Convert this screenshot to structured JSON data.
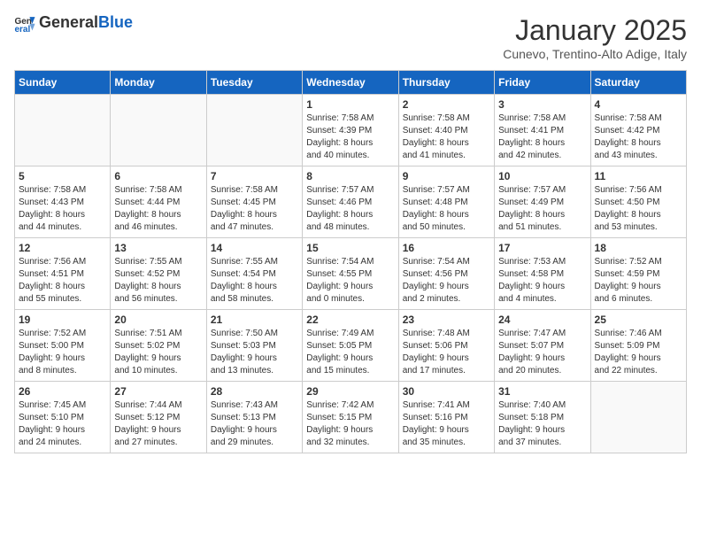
{
  "header": {
    "logo_general": "General",
    "logo_blue": "Blue",
    "title": "January 2025",
    "subtitle": "Cunevo, Trentino-Alto Adige, Italy"
  },
  "days_of_week": [
    "Sunday",
    "Monday",
    "Tuesday",
    "Wednesday",
    "Thursday",
    "Friday",
    "Saturday"
  ],
  "weeks": [
    {
      "alt": false,
      "days": [
        {
          "num": "",
          "empty": true
        },
        {
          "num": "",
          "empty": true
        },
        {
          "num": "",
          "empty": true
        },
        {
          "num": "1",
          "info": "Sunrise: 7:58 AM\nSunset: 4:39 PM\nDaylight: 8 hours\nand 40 minutes."
        },
        {
          "num": "2",
          "info": "Sunrise: 7:58 AM\nSunset: 4:40 PM\nDaylight: 8 hours\nand 41 minutes."
        },
        {
          "num": "3",
          "info": "Sunrise: 7:58 AM\nSunset: 4:41 PM\nDaylight: 8 hours\nand 42 minutes."
        },
        {
          "num": "4",
          "info": "Sunrise: 7:58 AM\nSunset: 4:42 PM\nDaylight: 8 hours\nand 43 minutes."
        }
      ]
    },
    {
      "alt": true,
      "days": [
        {
          "num": "5",
          "info": "Sunrise: 7:58 AM\nSunset: 4:43 PM\nDaylight: 8 hours\nand 44 minutes."
        },
        {
          "num": "6",
          "info": "Sunrise: 7:58 AM\nSunset: 4:44 PM\nDaylight: 8 hours\nand 46 minutes."
        },
        {
          "num": "7",
          "info": "Sunrise: 7:58 AM\nSunset: 4:45 PM\nDaylight: 8 hours\nand 47 minutes."
        },
        {
          "num": "8",
          "info": "Sunrise: 7:57 AM\nSunset: 4:46 PM\nDaylight: 8 hours\nand 48 minutes."
        },
        {
          "num": "9",
          "info": "Sunrise: 7:57 AM\nSunset: 4:48 PM\nDaylight: 8 hours\nand 50 minutes."
        },
        {
          "num": "10",
          "info": "Sunrise: 7:57 AM\nSunset: 4:49 PM\nDaylight: 8 hours\nand 51 minutes."
        },
        {
          "num": "11",
          "info": "Sunrise: 7:56 AM\nSunset: 4:50 PM\nDaylight: 8 hours\nand 53 minutes."
        }
      ]
    },
    {
      "alt": false,
      "days": [
        {
          "num": "12",
          "info": "Sunrise: 7:56 AM\nSunset: 4:51 PM\nDaylight: 8 hours\nand 55 minutes."
        },
        {
          "num": "13",
          "info": "Sunrise: 7:55 AM\nSunset: 4:52 PM\nDaylight: 8 hours\nand 56 minutes."
        },
        {
          "num": "14",
          "info": "Sunrise: 7:55 AM\nSunset: 4:54 PM\nDaylight: 8 hours\nand 58 minutes."
        },
        {
          "num": "15",
          "info": "Sunrise: 7:54 AM\nSunset: 4:55 PM\nDaylight: 9 hours\nand 0 minutes."
        },
        {
          "num": "16",
          "info": "Sunrise: 7:54 AM\nSunset: 4:56 PM\nDaylight: 9 hours\nand 2 minutes."
        },
        {
          "num": "17",
          "info": "Sunrise: 7:53 AM\nSunset: 4:58 PM\nDaylight: 9 hours\nand 4 minutes."
        },
        {
          "num": "18",
          "info": "Sunrise: 7:52 AM\nSunset: 4:59 PM\nDaylight: 9 hours\nand 6 minutes."
        }
      ]
    },
    {
      "alt": true,
      "days": [
        {
          "num": "19",
          "info": "Sunrise: 7:52 AM\nSunset: 5:00 PM\nDaylight: 9 hours\nand 8 minutes."
        },
        {
          "num": "20",
          "info": "Sunrise: 7:51 AM\nSunset: 5:02 PM\nDaylight: 9 hours\nand 10 minutes."
        },
        {
          "num": "21",
          "info": "Sunrise: 7:50 AM\nSunset: 5:03 PM\nDaylight: 9 hours\nand 13 minutes."
        },
        {
          "num": "22",
          "info": "Sunrise: 7:49 AM\nSunset: 5:05 PM\nDaylight: 9 hours\nand 15 minutes."
        },
        {
          "num": "23",
          "info": "Sunrise: 7:48 AM\nSunset: 5:06 PM\nDaylight: 9 hours\nand 17 minutes."
        },
        {
          "num": "24",
          "info": "Sunrise: 7:47 AM\nSunset: 5:07 PM\nDaylight: 9 hours\nand 20 minutes."
        },
        {
          "num": "25",
          "info": "Sunrise: 7:46 AM\nSunset: 5:09 PM\nDaylight: 9 hours\nand 22 minutes."
        }
      ]
    },
    {
      "alt": false,
      "days": [
        {
          "num": "26",
          "info": "Sunrise: 7:45 AM\nSunset: 5:10 PM\nDaylight: 9 hours\nand 24 minutes."
        },
        {
          "num": "27",
          "info": "Sunrise: 7:44 AM\nSunset: 5:12 PM\nDaylight: 9 hours\nand 27 minutes."
        },
        {
          "num": "28",
          "info": "Sunrise: 7:43 AM\nSunset: 5:13 PM\nDaylight: 9 hours\nand 29 minutes."
        },
        {
          "num": "29",
          "info": "Sunrise: 7:42 AM\nSunset: 5:15 PM\nDaylight: 9 hours\nand 32 minutes."
        },
        {
          "num": "30",
          "info": "Sunrise: 7:41 AM\nSunset: 5:16 PM\nDaylight: 9 hours\nand 35 minutes."
        },
        {
          "num": "31",
          "info": "Sunrise: 7:40 AM\nSunset: 5:18 PM\nDaylight: 9 hours\nand 37 minutes."
        },
        {
          "num": "",
          "empty": true
        }
      ]
    }
  ]
}
